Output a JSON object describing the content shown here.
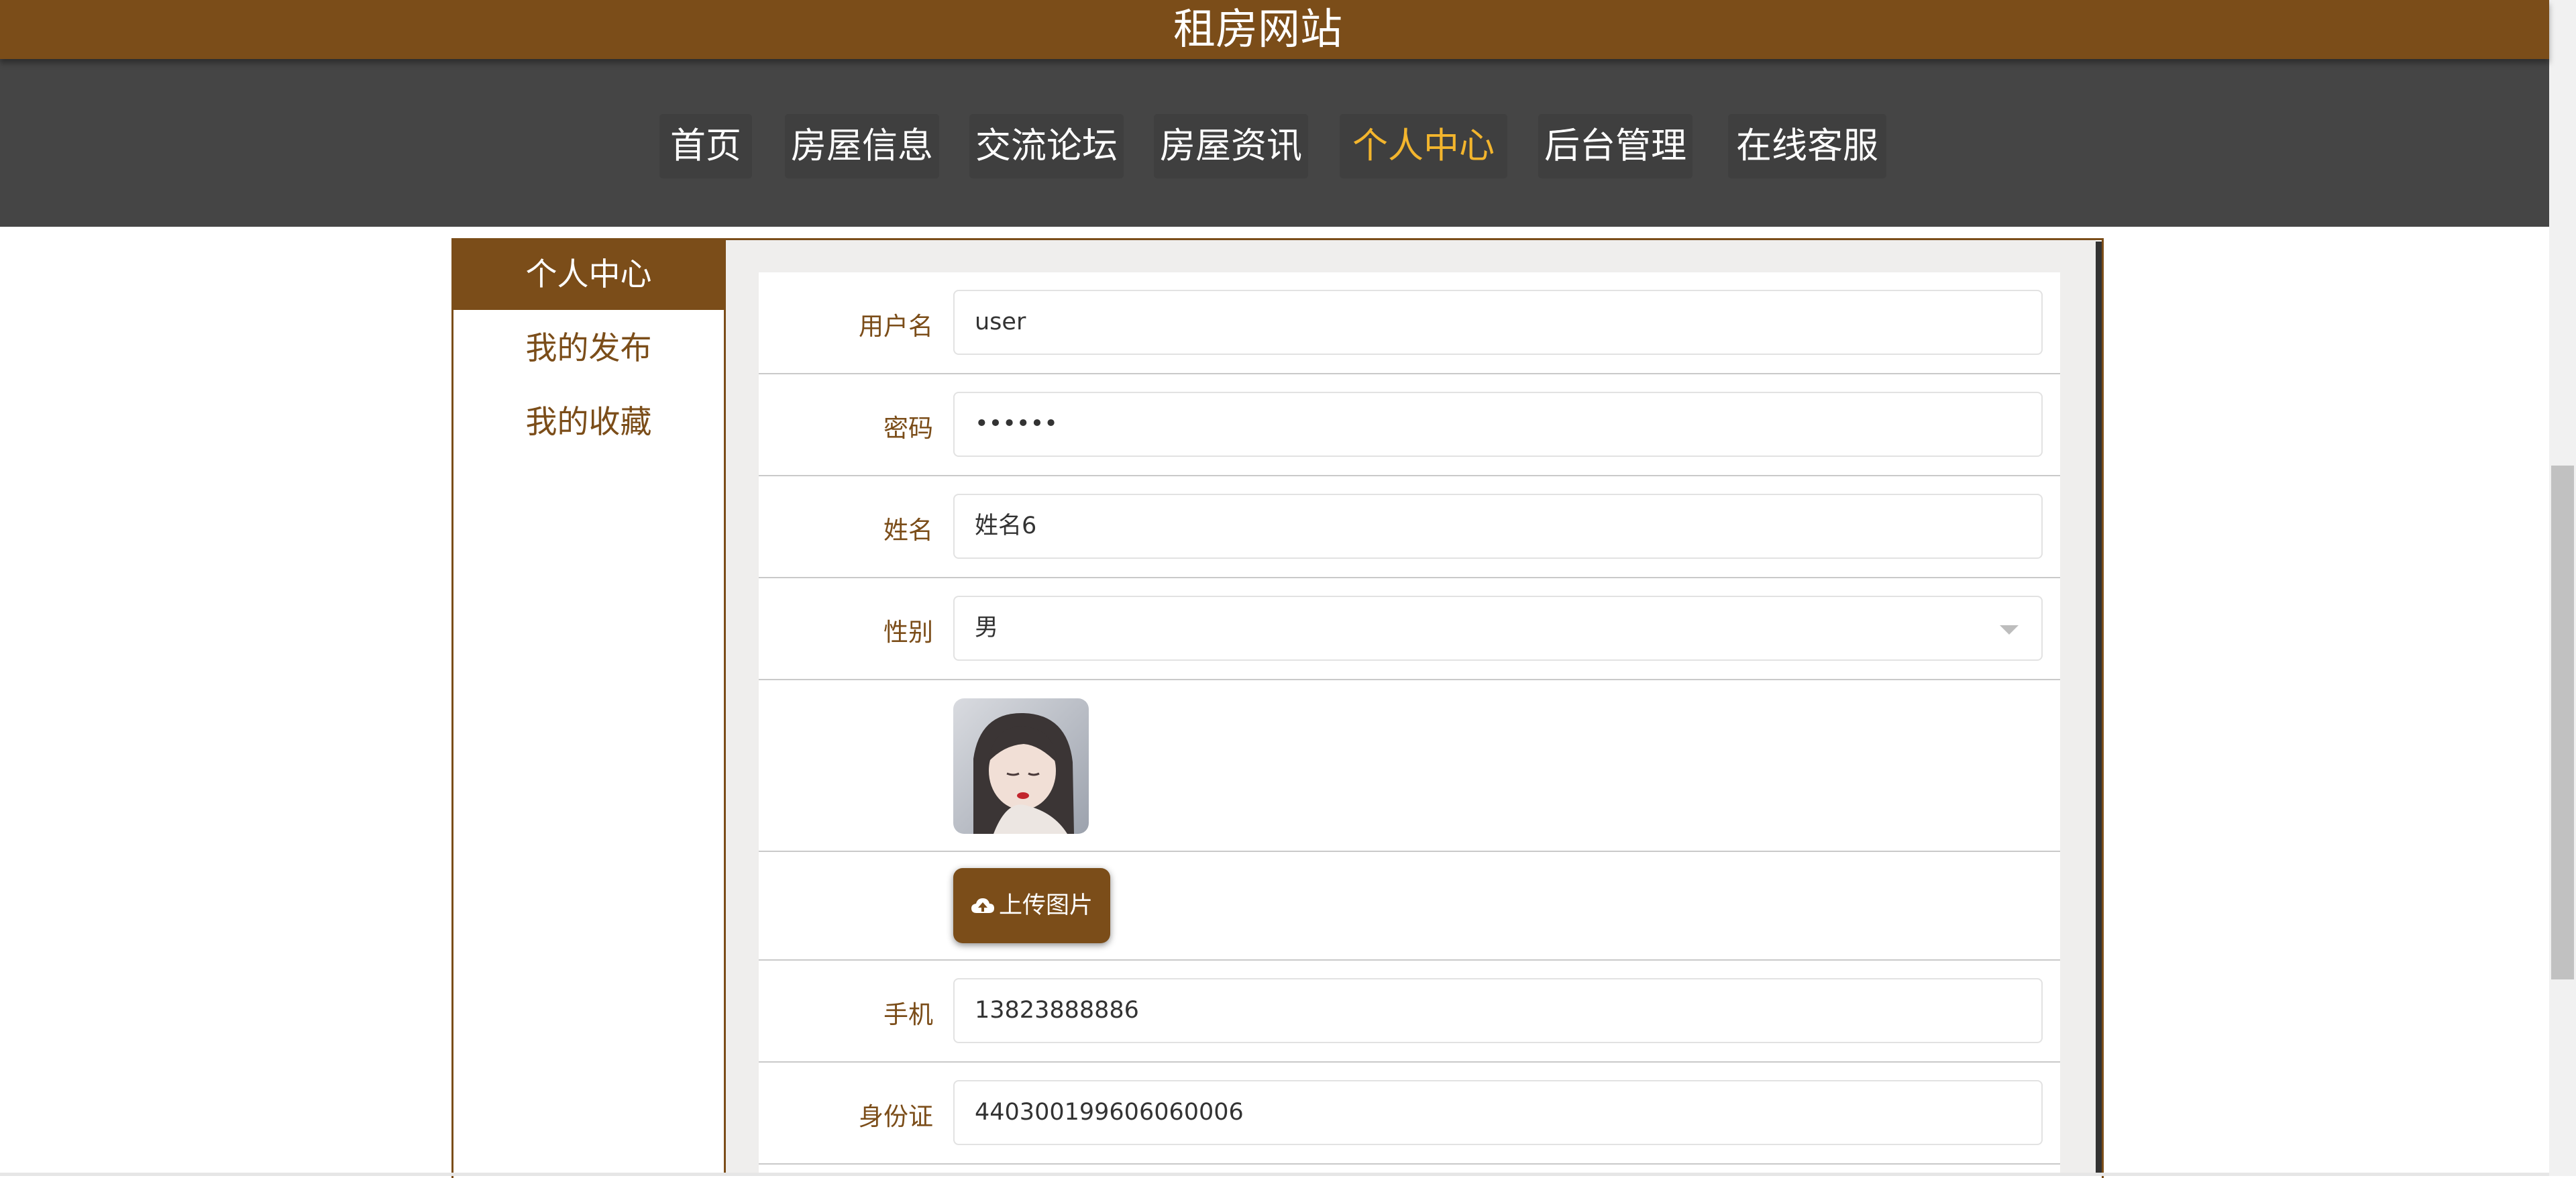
{
  "site": {
    "title": "租房网站"
  },
  "nav": {
    "items": [
      {
        "label": "首页"
      },
      {
        "label": "房屋信息"
      },
      {
        "label": "交流论坛"
      },
      {
        "label": "房屋资讯"
      },
      {
        "label": "个人中心",
        "active": true
      },
      {
        "label": "后台管理"
      },
      {
        "label": "在线客服"
      }
    ]
  },
  "sidebar": {
    "items": [
      {
        "label": "个人中心",
        "active": true
      },
      {
        "label": "我的发布"
      },
      {
        "label": "我的收藏"
      }
    ]
  },
  "form": {
    "username": {
      "label": "用户名",
      "value": "user"
    },
    "password": {
      "label": "密码",
      "value": "••••••"
    },
    "name": {
      "label": "姓名",
      "value": "姓名6"
    },
    "gender": {
      "label": "性别",
      "value": "男"
    },
    "upload": {
      "label": "上传图片"
    },
    "phone": {
      "label": "手机",
      "value": "13823888886"
    },
    "idcard": {
      "label": "身份证",
      "value": "440300199606060006"
    }
  },
  "colors": {
    "brand": "#7b4d19",
    "nav_bg": "#454545",
    "nav_active": "#f3b52d"
  }
}
